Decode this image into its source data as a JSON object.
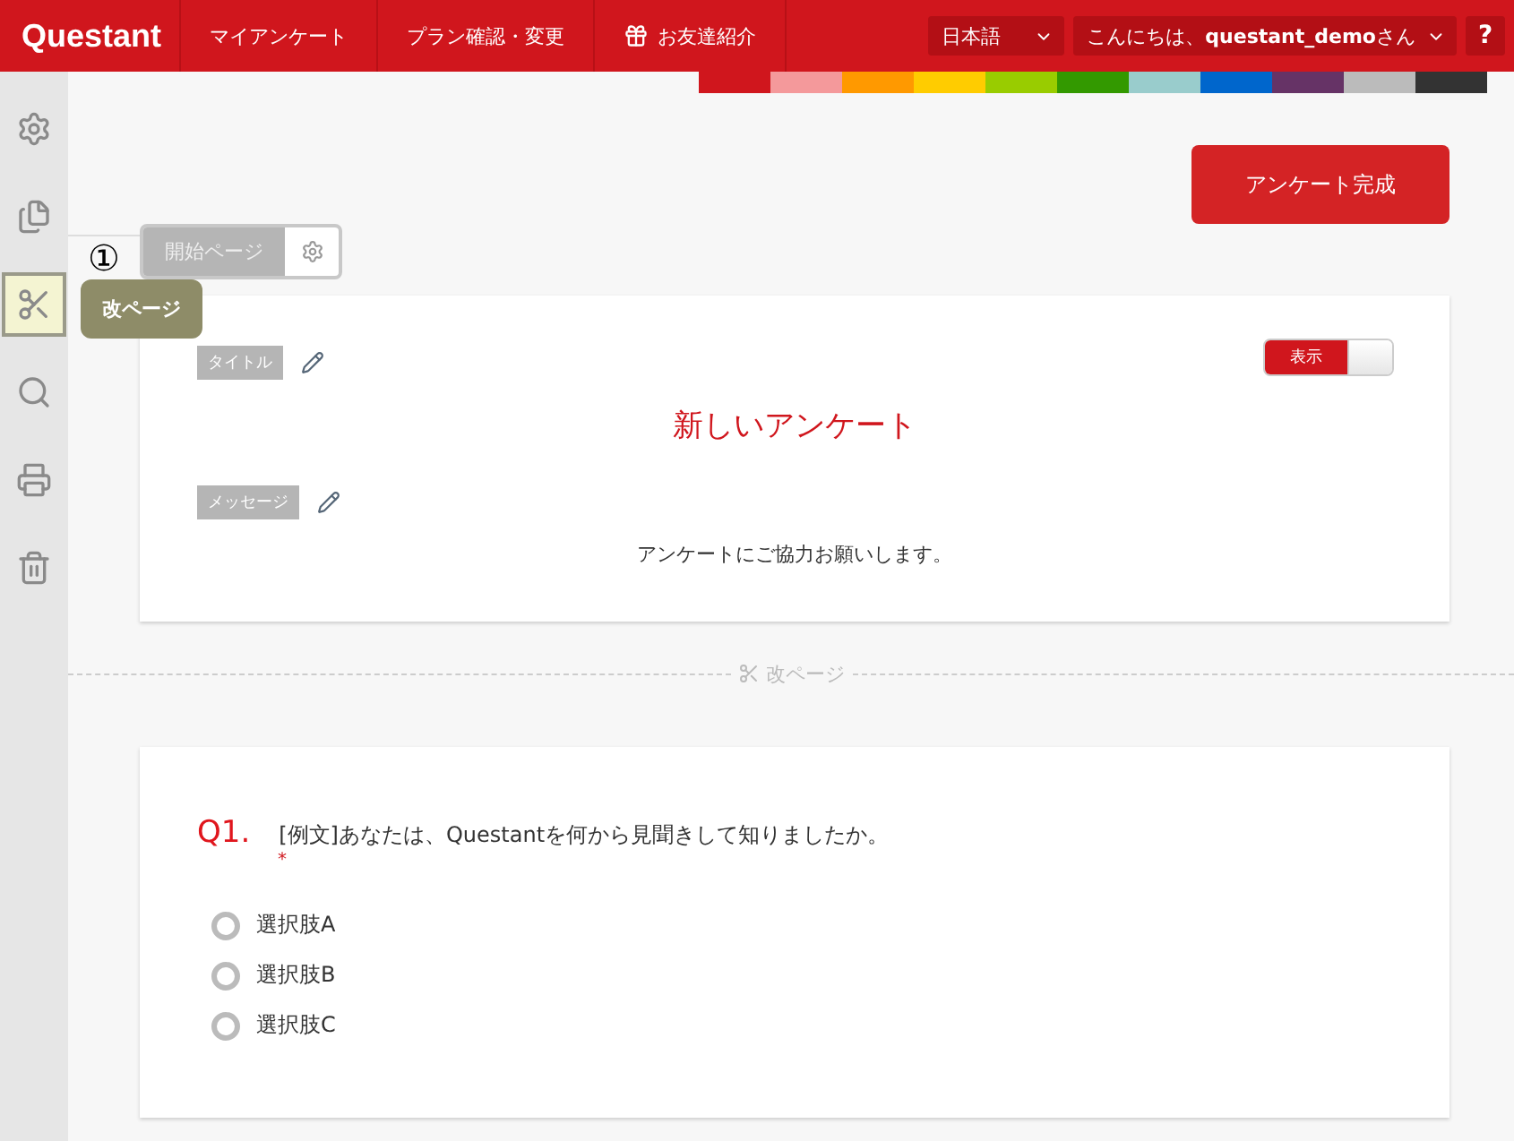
{
  "header": {
    "logo": "Questant",
    "nav": [
      {
        "label": "マイアンケート",
        "kind": "text"
      },
      {
        "label": "プラン確認・変更",
        "kind": "text"
      },
      {
        "label": "お友達紹介",
        "kind": "gift"
      }
    ],
    "language": "日本語",
    "greeting": "こんにちは、**questant_demo**さん",
    "help": "?"
  },
  "color_strip": [
    {
      "color": "#d0161d"
    },
    {
      "color": "#f4999b"
    },
    {
      "color": "#ff9900"
    },
    {
      "color": "#ffcc00"
    },
    {
      "color": "#99cc00"
    },
    {
      "color": "#339900"
    },
    {
      "color": "#99cccc"
    },
    {
      "color": "#0066cc"
    },
    {
      "color": "#663366"
    },
    {
      "color": "#bbbbbb"
    },
    {
      "color": "#333333"
    }
  ],
  "sidebar": {
    "items": [
      {
        "kind": "settings",
        "selected": false
      },
      {
        "kind": "copy",
        "selected": false
      },
      {
        "kind": "page-break",
        "selected": true,
        "tooltip": "改ページ"
      },
      {
        "kind": "search",
        "selected": false
      },
      {
        "kind": "print",
        "selected": false
      },
      {
        "kind": "trash",
        "selected": false
      }
    ]
  },
  "annotation": "①",
  "complete_button": "アンケート完成",
  "page_tab": {
    "label": "開始ページ"
  },
  "intro_card": {
    "title_label": "タイトル",
    "toggle": {
      "label": "表示",
      "on": true
    },
    "title": "新しいアンケート",
    "message_label": "メッセージ",
    "message": "アンケートにご協力お願いします。"
  },
  "page_break": "改ページ",
  "question": {
    "number": "Q1.",
    "text": "[例文]あなたは、Questantを何から見聞きして知りましたか。",
    "required_mark": "*",
    "options": [
      {
        "label": "選択肢A",
        "selected": false
      },
      {
        "label": "選択肢B",
        "selected": false
      },
      {
        "label": "選択肢C",
        "selected": false
      }
    ]
  }
}
